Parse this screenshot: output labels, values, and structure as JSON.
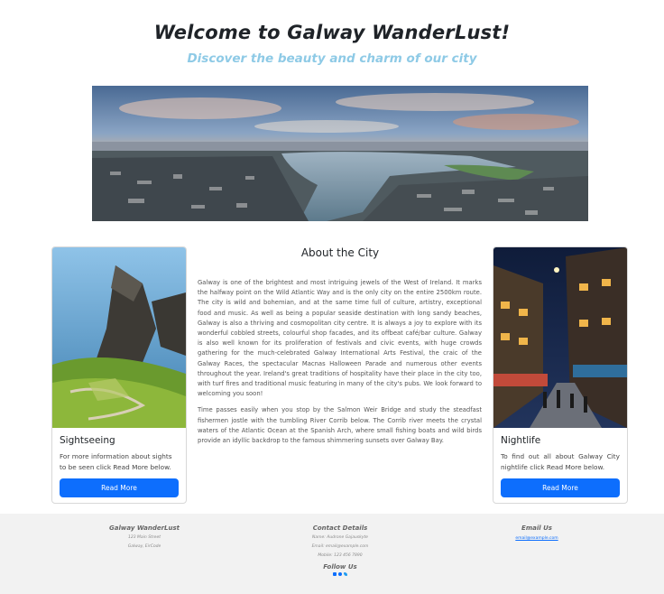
{
  "hero": {
    "title": "Welcome to Galway WanderLust!",
    "subtitle": "Discover the beauty and charm of our city"
  },
  "cards": {
    "left": {
      "title": "Sightseeing",
      "text": "For more information about sights to be seen click Read More below.",
      "button": "Read More"
    },
    "right": {
      "title": "Nightlife",
      "text": "To find out all about Galway City nightlife click Read More below.",
      "button": "Read More"
    }
  },
  "about": {
    "title": "About the City",
    "p1": "Galway is one of the brightest and most intriguing jewels of the West of Ireland. It marks the halfway point on the Wild Atlantic Way and is the only city on the entire 2500km route. The city is wild and bohemian, and at the same time full of culture, artistry, exceptional food and music. As well as being a popular seaside destination with long sandy beaches, Galway is also a thriving and cosmopolitan city centre. It is always a joy to explore with its wonderful cobbled streets, colourful shop facades, and its offbeat café/bar culture. Galway is also well known for its proliferation of festivals and civic events, with huge crowds gathering for the much-celebrated Galway International Arts Festival, the craic of the Galway Races, the spectacular Macnas Halloween Parade and numerous other events throughout the year. Ireland's great traditions of hospitality have their place in the city too, with turf fires and traditional music featuring in many of the city's pubs. We look forward to welcoming you soon!",
    "p2": "Time passes easily when you stop by the Salmon Weir Bridge and study the steadfast fishermen jostle with the tumbling River Corrib below. The Corrib river meets the crystal waters of the Atlantic Ocean at the Spanish Arch, where small fishing boats and wild birds provide an idyllic backdrop to the famous shimmering sunsets over Galway Bay."
  },
  "footer": {
    "brand": {
      "title": "Galway WanderLust",
      "line1": "123 Main Street",
      "line2": "Galway, EirCode"
    },
    "contact": {
      "title": "Contact Details",
      "line1": "Name: Audrone Gajauskyte",
      "line2": "Email: email@example.com",
      "line3": "Mobile: 123 456 7890",
      "follow": "Follow Us"
    },
    "email": {
      "title": "Email Us",
      "link": "email@example.com"
    }
  },
  "icons": {
    "social": [
      "instagram-icon",
      "facebook-icon",
      "twitter-icon"
    ]
  },
  "colors": {
    "accent": "#0d6efd",
    "subtitle": "#8ecae6",
    "footer_bg": "#f2f2f2"
  }
}
